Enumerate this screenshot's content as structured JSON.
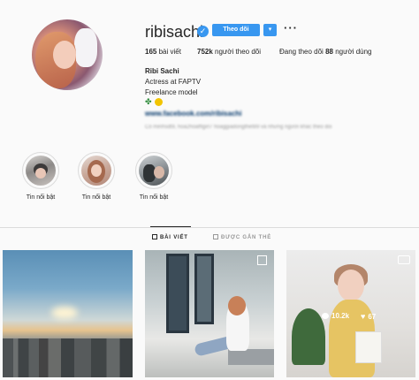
{
  "profile": {
    "username": "ribisachi",
    "verified_mark": "✓",
    "follow_label": "Theo dõi",
    "dropdown_glyph": "▾",
    "more_glyph": "···"
  },
  "stats": {
    "posts_count": "165",
    "posts_label": "bài viết",
    "followers_count": "752k",
    "followers_label": "người theo dõi",
    "following_prefix": "Đang theo dõi",
    "following_count": "88",
    "following_label": "người dùng"
  },
  "bio": {
    "name": "Ribi Sachi",
    "line1": "Actress at FAPTV",
    "line2": "Freelance model",
    "emoji_icons": [
      "four-leaf-clover-icon",
      "sun-icon"
    ],
    "link": "www.facebook.com/ribisachi",
    "followed_by": "Có minhsdt9, hoa2hoafflgirl7 hoaggiadongthet89 và những người khác theo dõi"
  },
  "highlights": [
    {
      "label": "Tin nổi bật",
      "icon": "highlight-avatar"
    },
    {
      "label": "Tin nổi bật",
      "icon": "highlight-avatar"
    },
    {
      "label": "Tin nổi bật",
      "icon": "highlight-avatar"
    }
  ],
  "tabs": [
    {
      "label": "BÀI VIẾT",
      "active": true,
      "icon": "grid-icon"
    },
    {
      "label": "ĐƯỢC GẮN THẺ",
      "active": false,
      "icon": "tag-icon"
    }
  ],
  "posts": [
    {
      "kind": "image",
      "subject": "city-sky"
    },
    {
      "kind": "carousel",
      "subject": "girl-sitting"
    },
    {
      "kind": "video",
      "subject": "girl-yellow-dress",
      "comments": "10.2k",
      "likes": "67"
    }
  ],
  "colors": {
    "accent": "#3897f0",
    "text": "#262626",
    "muted": "#999999",
    "background": "#fafafa"
  }
}
